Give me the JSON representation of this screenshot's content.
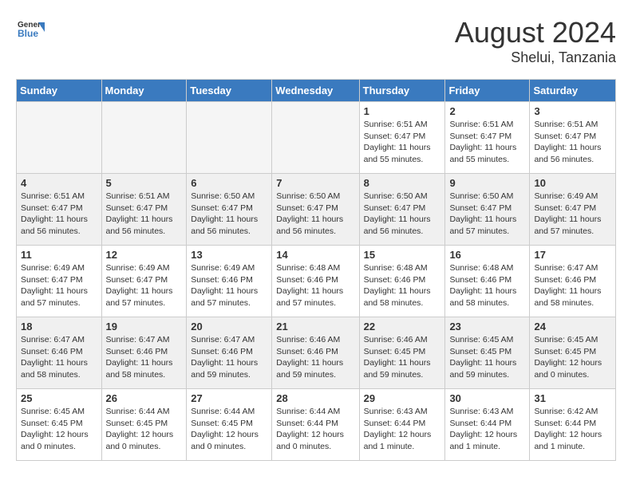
{
  "header": {
    "logo_line1": "General",
    "logo_line2": "Blue",
    "month": "August 2024",
    "location": "Shelui, Tanzania"
  },
  "days_of_week": [
    "Sunday",
    "Monday",
    "Tuesday",
    "Wednesday",
    "Thursday",
    "Friday",
    "Saturday"
  ],
  "weeks": [
    [
      {
        "day": "",
        "info": ""
      },
      {
        "day": "",
        "info": ""
      },
      {
        "day": "",
        "info": ""
      },
      {
        "day": "",
        "info": ""
      },
      {
        "day": "1",
        "info": "Sunrise: 6:51 AM\nSunset: 6:47 PM\nDaylight: 11 hours\nand 55 minutes."
      },
      {
        "day": "2",
        "info": "Sunrise: 6:51 AM\nSunset: 6:47 PM\nDaylight: 11 hours\nand 55 minutes."
      },
      {
        "day": "3",
        "info": "Sunrise: 6:51 AM\nSunset: 6:47 PM\nDaylight: 11 hours\nand 56 minutes."
      }
    ],
    [
      {
        "day": "4",
        "info": "Sunrise: 6:51 AM\nSunset: 6:47 PM\nDaylight: 11 hours\nand 56 minutes."
      },
      {
        "day": "5",
        "info": "Sunrise: 6:51 AM\nSunset: 6:47 PM\nDaylight: 11 hours\nand 56 minutes."
      },
      {
        "day": "6",
        "info": "Sunrise: 6:50 AM\nSunset: 6:47 PM\nDaylight: 11 hours\nand 56 minutes."
      },
      {
        "day": "7",
        "info": "Sunrise: 6:50 AM\nSunset: 6:47 PM\nDaylight: 11 hours\nand 56 minutes."
      },
      {
        "day": "8",
        "info": "Sunrise: 6:50 AM\nSunset: 6:47 PM\nDaylight: 11 hours\nand 56 minutes."
      },
      {
        "day": "9",
        "info": "Sunrise: 6:50 AM\nSunset: 6:47 PM\nDaylight: 11 hours\nand 57 minutes."
      },
      {
        "day": "10",
        "info": "Sunrise: 6:49 AM\nSunset: 6:47 PM\nDaylight: 11 hours\nand 57 minutes."
      }
    ],
    [
      {
        "day": "11",
        "info": "Sunrise: 6:49 AM\nSunset: 6:47 PM\nDaylight: 11 hours\nand 57 minutes."
      },
      {
        "day": "12",
        "info": "Sunrise: 6:49 AM\nSunset: 6:47 PM\nDaylight: 11 hours\nand 57 minutes."
      },
      {
        "day": "13",
        "info": "Sunrise: 6:49 AM\nSunset: 6:46 PM\nDaylight: 11 hours\nand 57 minutes."
      },
      {
        "day": "14",
        "info": "Sunrise: 6:48 AM\nSunset: 6:46 PM\nDaylight: 11 hours\nand 57 minutes."
      },
      {
        "day": "15",
        "info": "Sunrise: 6:48 AM\nSunset: 6:46 PM\nDaylight: 11 hours\nand 58 minutes."
      },
      {
        "day": "16",
        "info": "Sunrise: 6:48 AM\nSunset: 6:46 PM\nDaylight: 11 hours\nand 58 minutes."
      },
      {
        "day": "17",
        "info": "Sunrise: 6:47 AM\nSunset: 6:46 PM\nDaylight: 11 hours\nand 58 minutes."
      }
    ],
    [
      {
        "day": "18",
        "info": "Sunrise: 6:47 AM\nSunset: 6:46 PM\nDaylight: 11 hours\nand 58 minutes."
      },
      {
        "day": "19",
        "info": "Sunrise: 6:47 AM\nSunset: 6:46 PM\nDaylight: 11 hours\nand 58 minutes."
      },
      {
        "day": "20",
        "info": "Sunrise: 6:47 AM\nSunset: 6:46 PM\nDaylight: 11 hours\nand 59 minutes."
      },
      {
        "day": "21",
        "info": "Sunrise: 6:46 AM\nSunset: 6:46 PM\nDaylight: 11 hours\nand 59 minutes."
      },
      {
        "day": "22",
        "info": "Sunrise: 6:46 AM\nSunset: 6:45 PM\nDaylight: 11 hours\nand 59 minutes."
      },
      {
        "day": "23",
        "info": "Sunrise: 6:45 AM\nSunset: 6:45 PM\nDaylight: 11 hours\nand 59 minutes."
      },
      {
        "day": "24",
        "info": "Sunrise: 6:45 AM\nSunset: 6:45 PM\nDaylight: 12 hours\nand 0 minutes."
      }
    ],
    [
      {
        "day": "25",
        "info": "Sunrise: 6:45 AM\nSunset: 6:45 PM\nDaylight: 12 hours\nand 0 minutes."
      },
      {
        "day": "26",
        "info": "Sunrise: 6:44 AM\nSunset: 6:45 PM\nDaylight: 12 hours\nand 0 minutes."
      },
      {
        "day": "27",
        "info": "Sunrise: 6:44 AM\nSunset: 6:45 PM\nDaylight: 12 hours\nand 0 minutes."
      },
      {
        "day": "28",
        "info": "Sunrise: 6:44 AM\nSunset: 6:44 PM\nDaylight: 12 hours\nand 0 minutes."
      },
      {
        "day": "29",
        "info": "Sunrise: 6:43 AM\nSunset: 6:44 PM\nDaylight: 12 hours\nand 1 minute."
      },
      {
        "day": "30",
        "info": "Sunrise: 6:43 AM\nSunset: 6:44 PM\nDaylight: 12 hours\nand 1 minute."
      },
      {
        "day": "31",
        "info": "Sunrise: 6:42 AM\nSunset: 6:44 PM\nDaylight: 12 hours\nand 1 minute."
      }
    ]
  ]
}
